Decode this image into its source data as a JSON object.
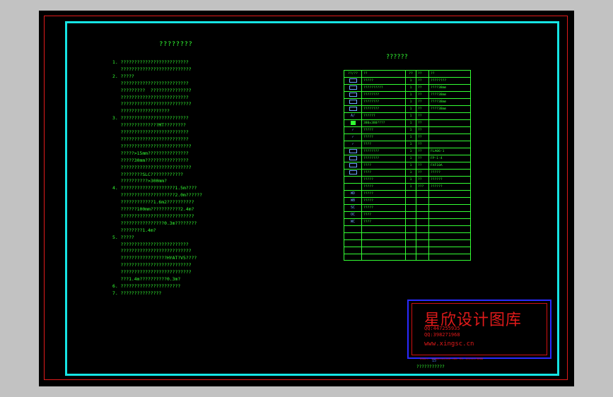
{
  "notes": {
    "title": "????????",
    "lines": [
      "1. ?????????????????????????",
      "   ??????????????????????????",
      "2. ?????",
      "   ?????????????????????????",
      "   ?????????  ???????????????",
      "   ?????????????????????????",
      "   ??????????????????????????",
      "   ??????????????????",
      "3. ?????????????????????????",
      "   ??????????????MT????????",
      "   ?????????????????????????",
      "   ?????????????????????????",
      "   ??????????????????????????",
      "   ?????>15mm???????????????",
      "   ?????30mm????????????????",
      "   ??????????????????????????",
      "   ????????SLC????????????",
      "   ??????????>300mm?",
      "4. ????????????????????1.5m????",
      "   ????????????????????2.0m??????",
      "   ????????????1.6m2??????????",
      "   ??????100mm???????????2.4m?",
      "   ???????????????????????????",
      "   ????????????????0.3m????????",
      "   ????????1.4m?",
      "5. ?????",
      "   ?????????????????????????",
      "   ??????????????????????????",
      "   ?????????????????HYAT?V5????",
      "   ??????????????????????????",
      "   ??????????????????????????",
      "   ???1.4m??????????0.3m?",
      "6. ??????????????????????",
      "7. ???????????????"
    ]
  },
  "table": {
    "title": "??????",
    "header": [
      "??/??",
      "??",
      "??",
      "??",
      "??"
    ],
    "rows": [
      {
        "sym": "rect",
        "name": "?????",
        "qty": "1",
        "unit": "??",
        "note": "????????"
      },
      {
        "sym": "rect2",
        "name": "??????????",
        "qty": "1",
        "unit": "??",
        "note": "????38mm"
      },
      {
        "sym": "rect",
        "name": "????????",
        "qty": "1",
        "unit": "??",
        "note": "????38mm"
      },
      {
        "sym": "rect",
        "name": "????????",
        "qty": "1",
        "unit": "??",
        "note": "????38mm"
      },
      {
        "sym": "rect",
        "name": "????????",
        "qty": "1",
        "unit": "??",
        "note": "????38mm"
      },
      {
        "sym": "text",
        "name": "??????",
        "qty": "1",
        "unit": "??",
        "note": ""
      },
      {
        "sym": "fill",
        "name": "380x380????",
        "qty": "1",
        "unit": "??",
        "note": ""
      },
      {
        "sym": "check",
        "name": "?????",
        "qty": "1",
        "unit": "??",
        "note": ""
      },
      {
        "sym": "check",
        "name": "?????",
        "qty": "1",
        "unit": "??",
        "note": ""
      },
      {
        "sym": "check",
        "name": "????",
        "qty": "1",
        "unit": "??",
        "note": ""
      },
      {
        "sym": "rect",
        "name": "????????",
        "qty": "1",
        "unit": "??",
        "note": "FLA06-1"
      },
      {
        "sym": "rect",
        "name": "????????",
        "qty": "1",
        "unit": "??",
        "note": "FP-1-4"
      },
      {
        "sym": "rect",
        "name": "????",
        "qty": "1",
        "unit": "??",
        "note": "FXF10A"
      },
      {
        "sym": "rect",
        "name": "????",
        "qty": "1",
        "unit": "??",
        "note": "?????"
      },
      {
        "sym": "",
        "name": "?????",
        "qty": "1",
        "unit": "??",
        "note": "??????"
      },
      {
        "sym": "",
        "name": "?????",
        "qty": "1",
        "unit": "???",
        "note": "??????"
      },
      {
        "sym": "text",
        "name": "?????",
        "qty": "",
        "unit": "",
        "note": ""
      },
      {
        "sym": "text",
        "name": "?????",
        "qty": "",
        "unit": "",
        "note": ""
      },
      {
        "sym": "text",
        "name": "?????",
        "qty": "",
        "unit": "",
        "note": ""
      },
      {
        "sym": "text",
        "name": "????",
        "qty": "",
        "unit": "",
        "note": ""
      },
      {
        "sym": "text",
        "name": "????",
        "qty": "",
        "unit": "",
        "note": ""
      },
      {
        "sym": "",
        "name": "",
        "qty": "",
        "unit": "",
        "note": ""
      },
      {
        "sym": "",
        "name": "",
        "qty": "",
        "unit": "",
        "note": ""
      },
      {
        "sym": "",
        "name": "",
        "qty": "",
        "unit": "",
        "note": ""
      },
      {
        "sym": "",
        "name": "",
        "qty": "",
        "unit": "",
        "note": ""
      },
      {
        "sym": "",
        "name": "",
        "qty": "",
        "unit": "",
        "note": ""
      }
    ],
    "row_symbol_texts": [
      "",
      "",
      "",
      "",
      "",
      "A/",
      "",
      "",
      "",
      "",
      "",
      "",
      "",
      "",
      "",
      "",
      "WD",
      "WB",
      "SC",
      "OC",
      "WC"
    ]
  },
  "stamp": {
    "name": "星欣设计图库",
    "qq1": "QQ:447255935",
    "qq2": "QQ:398271968",
    "url": "www.xingsc.cn",
    "small": "Email: xingscsc@126.com  TEL:13111179808"
  },
  "below_stamp": "???????????",
  "blue_mark": "15"
}
